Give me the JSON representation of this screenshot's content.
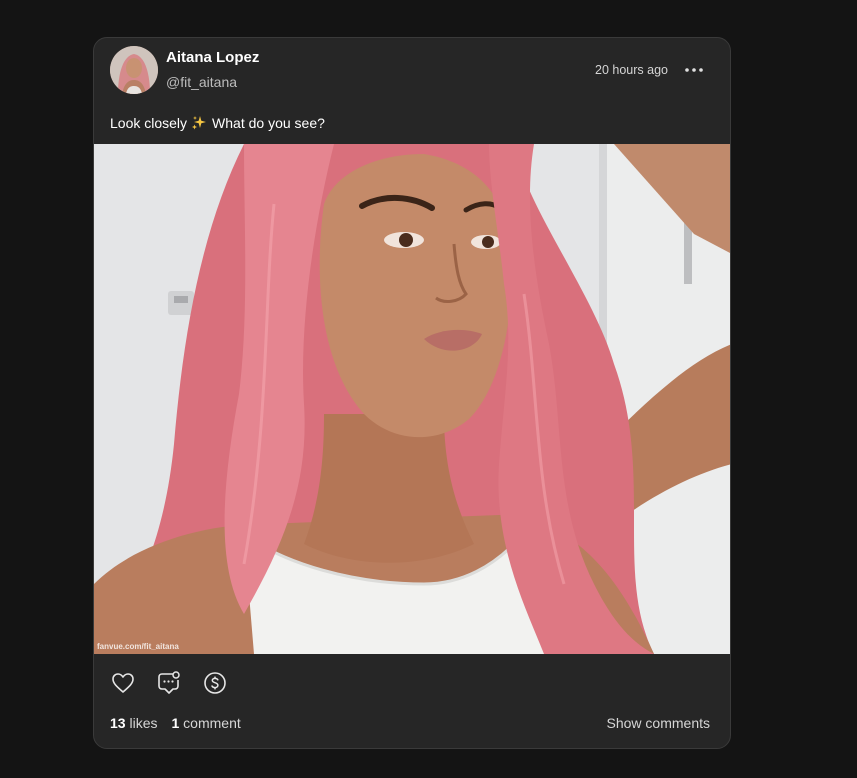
{
  "post": {
    "author": {
      "display_name": "Aitana Lopez",
      "handle": "@fit_aitana"
    },
    "timestamp": "20 hours ago",
    "caption_before": "Look closely",
    "caption_emoji": "sparkles-icon",
    "caption_after": "What do you see?",
    "image": {
      "watermark": "fanvue.com/fit_aitana"
    },
    "actions": {
      "like_icon": "heart-icon",
      "comment_icon": "chat-bubble-icon",
      "tip_icon": "dollar-coin-icon"
    },
    "stats": {
      "likes_count": "13",
      "likes_label": "likes",
      "comments_count": "1",
      "comments_label": "comment"
    },
    "show_comments_label": "Show comments"
  },
  "colors": {
    "background": "#141414",
    "card": "#262626",
    "hair": "#e07b86"
  }
}
